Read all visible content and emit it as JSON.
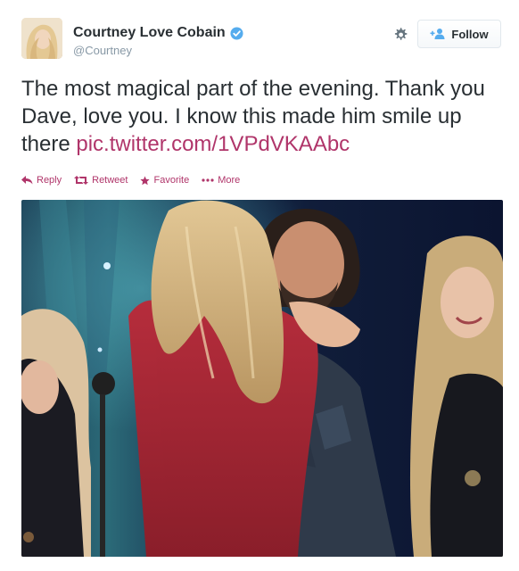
{
  "user": {
    "name": "Courtney Love Cobain",
    "screen_name": "@Courtney",
    "verified": true
  },
  "follow_button": {
    "label": "Follow"
  },
  "tweet": {
    "text": "The most magical part of the evening.  Thank you Dave,  love you.  I know this made him smile up there ",
    "link_text": "pic.twitter.com/1VPdVKAAbc"
  },
  "actions": {
    "reply": "Reply",
    "retweet": "Retweet",
    "favorite": "Favorite",
    "more": "More"
  },
  "colors": {
    "link": "#b0356a",
    "verified": "#55acee",
    "muted": "#8899a6"
  }
}
